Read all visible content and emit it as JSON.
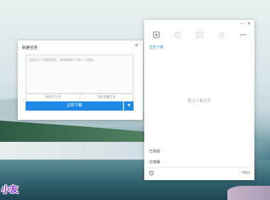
{
  "dialog": {
    "title": "新建任务",
    "close": "×",
    "url_placeholder": "添加多个下载链接时，请确保每行只有一个链接。",
    "add_bt": "添加BT任务",
    "add_magnet": "添加批量任务",
    "download_now": "立即下载",
    "caret": "▼"
  },
  "panel": {
    "minimize": "—",
    "close": "×",
    "tab_downloading": "正在下载",
    "empty": "暂无下载任务",
    "completed": "已完成",
    "recycle": "垃圾桶",
    "speed": "0B/s"
  },
  "watermark": "小友",
  "colors": {
    "accent": "#1e88e5"
  }
}
